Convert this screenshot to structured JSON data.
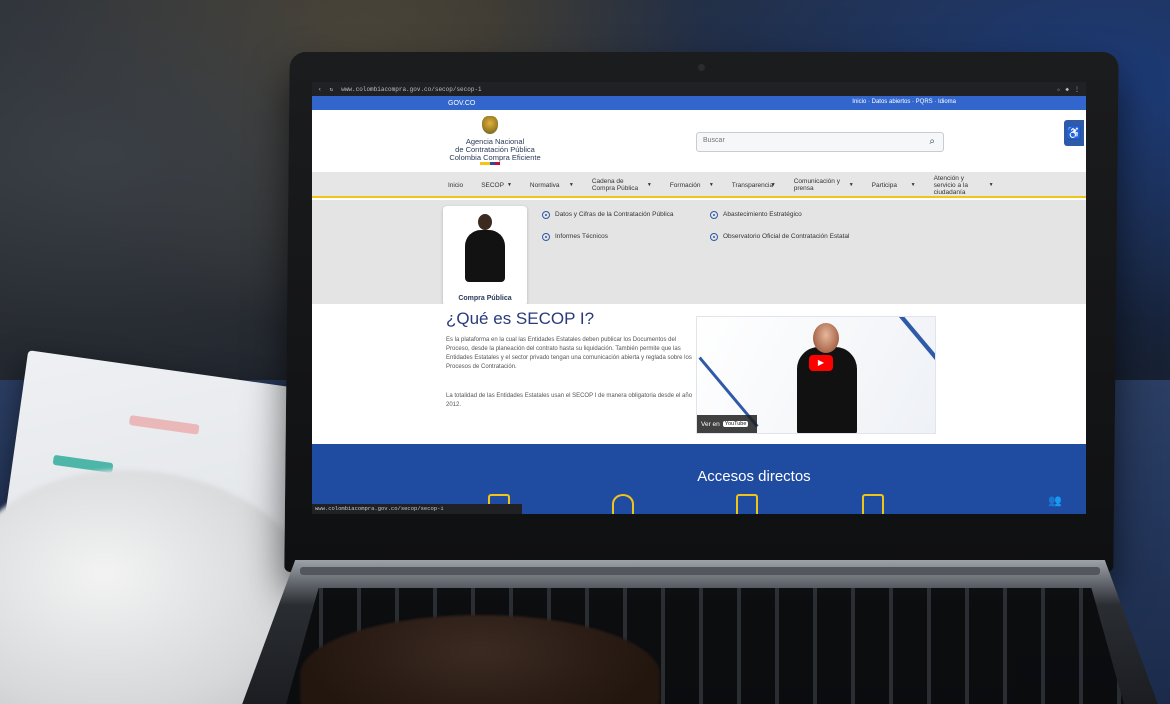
{
  "browser": {
    "url": "www.colombiacompra.gov.co/secop/secop-i",
    "icons": [
      "back-icon",
      "reload-icon",
      "star-icon",
      "extension-icon",
      "menu-icon"
    ]
  },
  "gov_bar": {
    "brand": "GOV.CO",
    "links": "Inicio · Datos abiertos · PQRS · Idioma"
  },
  "header": {
    "logo_lines": [
      "Agencia Nacional",
      "de Contratación Pública",
      "Colombia Compra Eficiente"
    ],
    "search_placeholder": "Buscar"
  },
  "nav": {
    "items": [
      {
        "label": "Inicio",
        "chevron": false
      },
      {
        "label": "SECOP",
        "chevron": true
      },
      {
        "label": "Normativa",
        "chevron": true
      },
      {
        "label": "Cadena de Compra Pública",
        "chevron": true
      },
      {
        "label": "Formación",
        "chevron": true
      },
      {
        "label": "Transparencia",
        "chevron": true
      },
      {
        "label": "Comunicación y prensa",
        "chevron": true
      },
      {
        "label": "Participa",
        "chevron": true
      },
      {
        "label": "Atención y servicio a la ciudadanía",
        "chevron": true
      }
    ]
  },
  "mega_menu": {
    "signer_caption": "Compra Pública",
    "links": [
      "Datos y Cifras de la Contratación Pública",
      "Informes Técnicos",
      "Abastecimiento Estratégico",
      "Observatorio Oficial de Contratación Estatal"
    ]
  },
  "content": {
    "title": "¿Qué es SECOP I?",
    "paragraph_1": "Es la plataforma en la cual las Entidades Estatales deben publicar los Documentos del Proceso, desde la planeación del contrato hasta su liquidación. También permite que las Entidades Estatales y el sector privado tengan una comunicación abierta y reglada sobre los Procesos de Contratación.",
    "paragraph_2": "La totalidad de las Entidades Estatales usan el SECOP I de manera obligatoria desde el año 2012.",
    "watch_label": "Ver en",
    "youtube_label": "YouTube"
  },
  "shortcuts": {
    "title": "Accesos directos"
  },
  "status_bar": {
    "url": "www.colombiacompra.gov.co/secop/secop-i"
  },
  "colors": {
    "gov_blue": "#3366cc",
    "section_blue": "#1f4ba1",
    "accent_yellow": "#f0c419",
    "title_navy": "#2a3a7a"
  }
}
